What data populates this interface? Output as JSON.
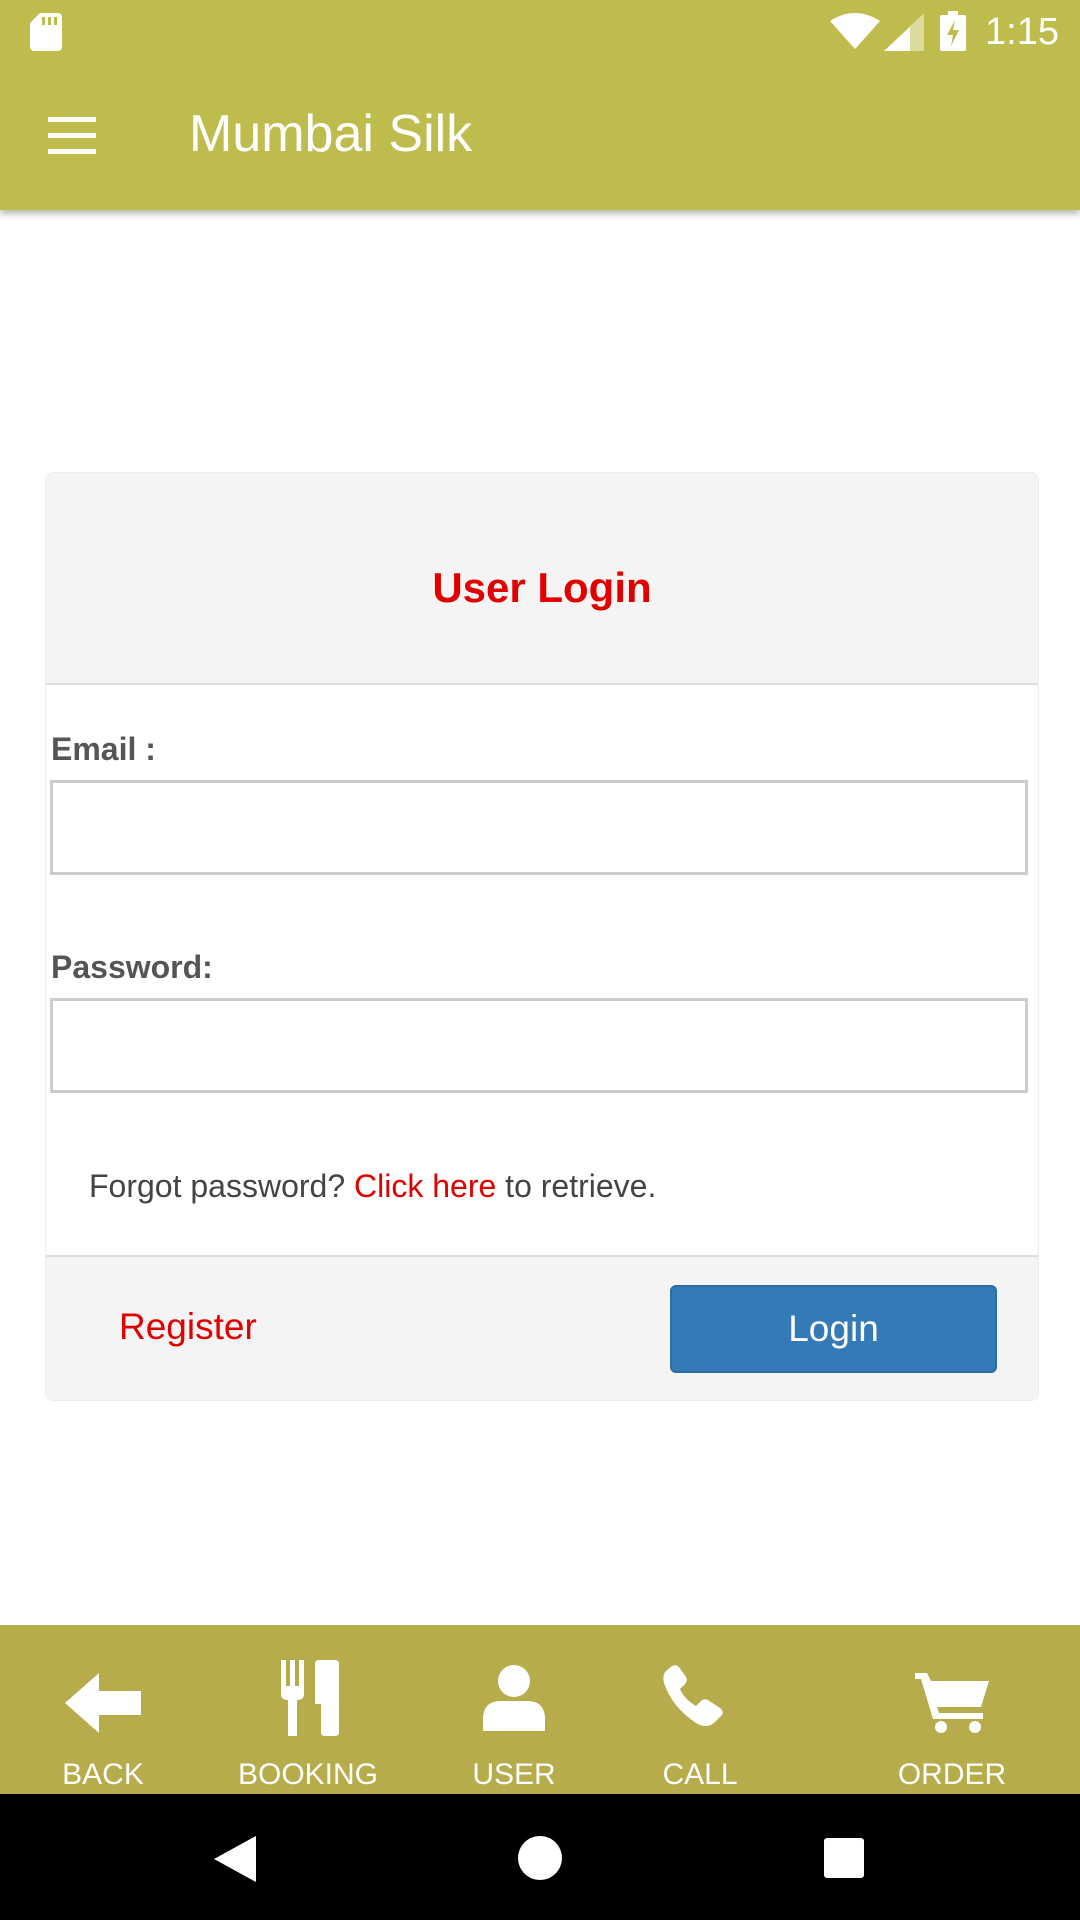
{
  "status_bar": {
    "time": "1:15",
    "icons": [
      "sd-card-icon",
      "wifi-icon",
      "signal-icon",
      "battery-charging-icon"
    ]
  },
  "app_bar": {
    "title": "Mumbai Silk",
    "menu_icon": "hamburger-menu-icon"
  },
  "login_card": {
    "title": "User Login",
    "email_label": "Email :",
    "email_value": "",
    "password_label": "Password:",
    "password_value": "",
    "forgot_prefix": "Forgot password?",
    "forgot_link": "Click here",
    "forgot_suffix": "to retrieve.",
    "register_label": "Register",
    "login_label": "Login"
  },
  "bottom_nav": {
    "items": [
      {
        "label": "BACK",
        "icon": "back-arrow-icon"
      },
      {
        "label": "BOOKING",
        "icon": "fork-knife-icon"
      },
      {
        "label": "USER",
        "icon": "user-icon"
      },
      {
        "label": "CALL",
        "icon": "phone-icon"
      },
      {
        "label": "ORDER",
        "icon": "cart-icon"
      }
    ]
  },
  "system_nav": {
    "buttons": [
      "back-triangle-icon",
      "home-circle-icon",
      "recents-square-icon"
    ]
  },
  "colors": {
    "app_bar": "#bfbc4e",
    "bottom_nav": "#b7ac4c",
    "accent_red": "#e00000",
    "login_button": "#337ab7"
  }
}
